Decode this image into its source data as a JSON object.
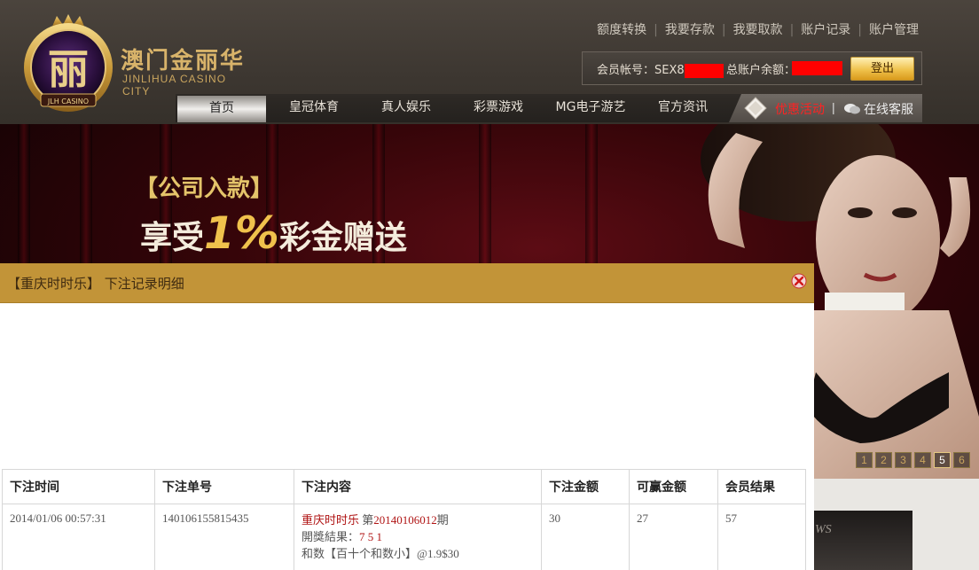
{
  "brand": {
    "name_cn": "澳门金丽华",
    "name_en": "JINLIHUA CASINO CITY",
    "seal_monogram": "丽",
    "seal_text": "JLH CASINO"
  },
  "top_links": [
    "额度转换",
    "我要存款",
    "我要取款",
    "账户记录",
    "账户管理"
  ],
  "account": {
    "account_label": "会员帐号：",
    "account_prefix": "SEX8",
    "balance_label": "总账户余额：",
    "logout_label": "登出"
  },
  "nav": {
    "items": [
      "首页",
      "皇冠体育",
      "真人娱乐",
      "彩票游戏",
      "MG电子游艺",
      "官方资讯"
    ],
    "active_index": 0,
    "promo_label": "优惠活动",
    "separator": "|",
    "service_label": "在线客服"
  },
  "banner": {
    "tag": "【公司入款】",
    "headline_prefix": "享受",
    "headline_pct": "1%",
    "headline_suffix": "彩金赠送",
    "pager": [
      "1",
      "2",
      "3",
      "4",
      "5",
      "6"
    ],
    "active_page": "5"
  },
  "side_panel": {
    "partial_text": "WS"
  },
  "dialog": {
    "title": "【重庆时时乐】 下注记录明细",
    "table": {
      "headers": [
        "下注时间",
        "下注单号",
        "下注内容",
        "下注金额",
        "可赢金额",
        "会员结果"
      ],
      "rows": [
        {
          "time": "2014/01/06 00:57:31",
          "order_no": "140106155815435",
          "content": {
            "game": "重庆时时乐",
            "period_prefix": " 第",
            "period": "20140106012",
            "period_suffix": "期",
            "result_label": " 開獎結果：",
            "result_value": "7 5 1",
            "bet_detail": "和数【百十个和数小】@1.9$30"
          },
          "amount": "30",
          "winnable": "27",
          "result": "57"
        }
      ]
    }
  },
  "colors": {
    "accent_gold": "#c29438",
    "promo_red": "#ff2222",
    "redaction": "#ff0000"
  }
}
